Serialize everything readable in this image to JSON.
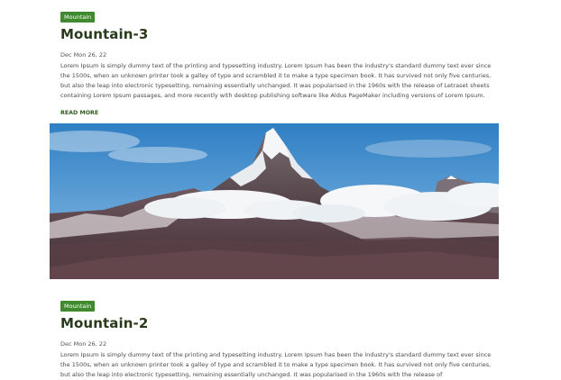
{
  "posts": [
    {
      "category": "Mountain",
      "title": "Mountain-3",
      "date": "Dec Mon 26, 22",
      "excerpt": "Lorem Ipsum is simply dummy text of the printing and typesetting industry. Lorem Ipsum has been the industry's standard dummy text ever since the 1500s, when an unknown printer took a galley of type and scrambled it to make a type specimen book. It has survived not only five centuries, but also the leap into electronic typesetting, remaining essentially unchanged. It was popularised in the 1960s with the release of Letraset sheets containing Lorem Ipsum passages, and more recently with desktop publishing software like Aldus PageMaker including versions of Lorem Ipsum.",
      "read_more": "READ MORE"
    },
    {
      "category": "Mountain",
      "title": "Mountain-2",
      "date": "Dec Mon 26, 22",
      "excerpt": "Lorem Ipsum is simply dummy text of the printing and typesetting industry. Lorem Ipsum has been the industry's standard dummy text ever since the 1500s, when an unknown printer took a galley of type and scrambled it to make a type specimen book. It has survived not only five centuries, but also the leap into electronic typesetting, remaining essentially unchanged. It was popularised in the 1960s with the release of"
    }
  ],
  "colors": {
    "tag_bg": "#3f8a2f",
    "title": "#2a3a1c",
    "read_more": "#2f5d1f"
  },
  "hero_image": {
    "subject": "snow-capped mountain peak above clouds, blue sky"
  }
}
